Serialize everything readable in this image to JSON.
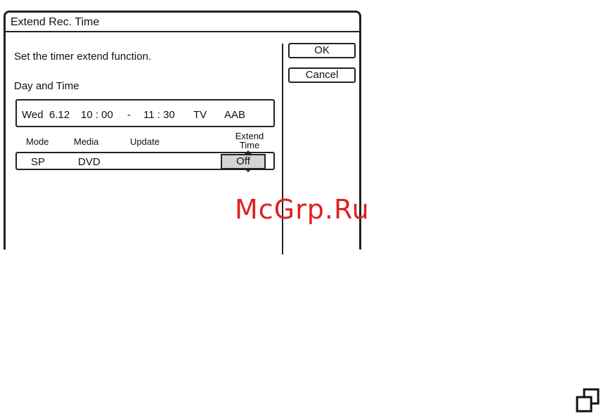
{
  "dialog": {
    "title": "Extend Rec. Time",
    "instruction": "Set the timer extend function.",
    "day_time_label": "Day and Time",
    "day_time": {
      "day": "Wed",
      "date": "6.12",
      "start": "10 : 00",
      "separator": "-",
      "end": "11 : 30",
      "source": "TV",
      "channel": "AAB"
    },
    "columns": {
      "mode": "Mode",
      "media": "Media",
      "update": "Update",
      "extend_line1": "Extend",
      "extend_line2": "Time"
    },
    "row": {
      "mode": "SP",
      "media": "DVD",
      "update": "",
      "extend_time": "Off"
    },
    "buttons": {
      "ok": "OK",
      "cancel": "Cancel"
    }
  },
  "watermark": "McGrp.Ru",
  "colors": {
    "watermark": "#dd2222",
    "selected_cell": "#d4d4d4",
    "border": "#222222"
  },
  "icons": [
    "up-arrow-icon",
    "down-arrow-icon",
    "copy-windows-icon"
  ]
}
